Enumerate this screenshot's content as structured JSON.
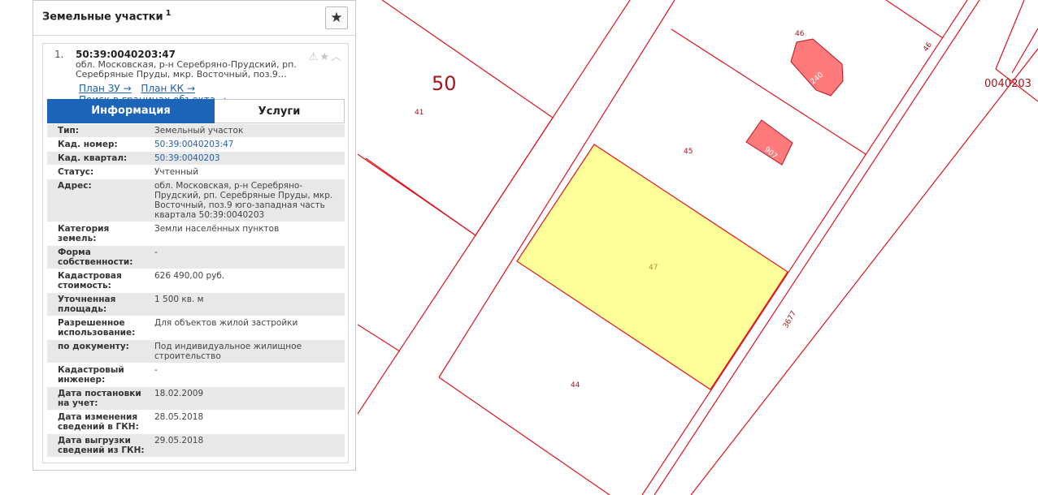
{
  "panel": {
    "title": "Земельные участки",
    "count": "1",
    "favorite_icon": "star-icon"
  },
  "card": {
    "index": "1.",
    "cad_number": "50:39:0040203:47",
    "address_short": "обл. Московская, р-н Серебряно-Прудский, рп. Серебряные Пруды, мкр. Восточный, поз.9…",
    "icons": [
      "warning-icon",
      "star-icon",
      "chevron-up-icon"
    ],
    "links": [
      "План ЗУ →",
      "План КК →",
      "Поиск в границах объекта →"
    ]
  },
  "tabs": [
    {
      "label": "Информация",
      "active": true
    },
    {
      "label": "Услуги",
      "active": false
    }
  ],
  "info_rows": [
    {
      "key": "Тип:",
      "value": "Земельный участок"
    },
    {
      "key": "Кад. номер:",
      "value": "50:39:0040203:47",
      "link": true
    },
    {
      "key": "Кад. квартал:",
      "value": "50:39:0040203",
      "link": true
    },
    {
      "key": "Статус:",
      "value": "Учтенный"
    },
    {
      "key": "Адрес:",
      "value": "обл. Московская, р-н Серебряно-Прудский, рп. Серебряные Пруды, мкр. Восточный, поз.9 юго-западная часть квартала 50:39:0040203"
    },
    {
      "key": "Категория земель:",
      "value": "Земли населённых пунктов"
    },
    {
      "key": "Форма собственности:",
      "value": "-"
    },
    {
      "key": "Кадастровая стоимость:",
      "value": "626 490,00 руб."
    },
    {
      "key": "Уточненная площадь:",
      "value": "1 500 кв. м"
    },
    {
      "key": "Разрешенное использование:",
      "value": "Для объектов жилой застройки"
    },
    {
      "key": "по документу:",
      "value": "Под индивидуальное жилищное строительство"
    },
    {
      "key": "Кадастровый инженер:",
      "value": "-"
    },
    {
      "key": "Дата постановки на учет:",
      "value": "18.02.2009"
    },
    {
      "key": "Дата изменения сведений в ГКН:",
      "value": "28.05.2018"
    },
    {
      "key": "Дата выгрузки сведений из ГКН:",
      "value": "29.05.2018"
    }
  ],
  "map": {
    "district_label": "50",
    "quarter_label": "0040203",
    "parcel_labels": [
      "41",
      "45",
      "46",
      "47",
      "44",
      "46",
      "3677"
    ],
    "building_labels": [
      "240",
      "907"
    ],
    "colors": {
      "border": "#e0141e",
      "selected_fill": "#ffff99",
      "building_fill": "#ff7b7b",
      "district_label": "#a5141a"
    }
  }
}
